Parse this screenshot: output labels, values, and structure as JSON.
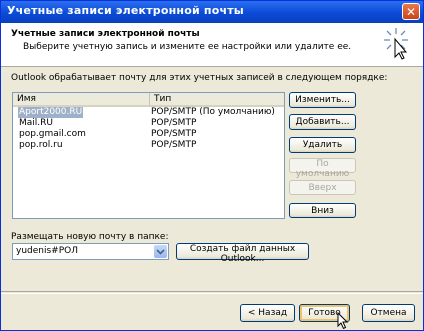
{
  "window": {
    "title": "Учетные записи электронной почты",
    "close_label": "✕"
  },
  "header": {
    "title": "Учетные записи электронной почты",
    "subtitle": "Выберите учетную запись и измените ее настройки или удалите ее."
  },
  "accounts": {
    "description": "Outlook обрабатывает почту для этих учетных записей в следующем порядке:",
    "columns": [
      "Имя",
      "Тип"
    ],
    "rows": [
      {
        "name": "Aport2000.RU",
        "type": "POP/SMTP (По умолчанию)",
        "selected": true
      },
      {
        "name": "Mail.RU",
        "type": "POP/SMTP"
      },
      {
        "name": "pop.gmail.com",
        "type": "POP/SMTP"
      },
      {
        "name": "pop.rol.ru",
        "type": "POP/SMTP"
      }
    ]
  },
  "side_buttons": {
    "change": "Изменить...",
    "add": "Добавить...",
    "delete": "Удалить",
    "default": "По умолчанию",
    "up": "Вверх",
    "down": "Вниз"
  },
  "delivery": {
    "label": "Размещать новую почту в папке:",
    "folder_value": "yudenis#РОЛ",
    "create_datafile": "Создать файл данных Outlook..."
  },
  "footer": {
    "back": "< Назад",
    "finish": "Готово",
    "cancel": "Отмена"
  },
  "colors": {
    "titlebar": "#0b4bd6",
    "dialog_bg": "#ece9d8",
    "selection": "#9fb1c9"
  }
}
